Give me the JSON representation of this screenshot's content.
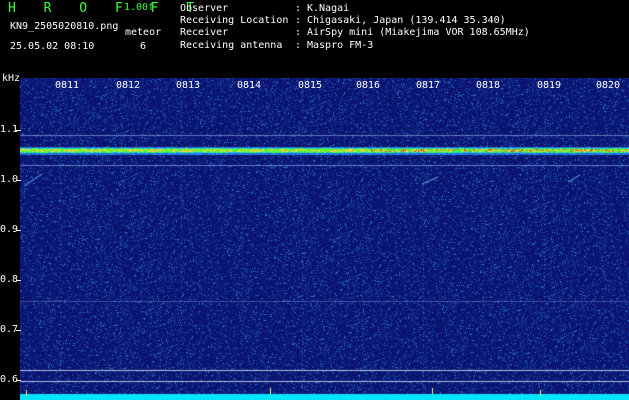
{
  "header": {
    "title": "H R O F F T",
    "version": "1.00f",
    "filename": "KN9_2505020810.png",
    "meteor_label": "meteor",
    "datetime": "25.05.02 08:10",
    "meteor_count": "6"
  },
  "info": [
    {
      "label": "Observer",
      "value": "K.Nagai"
    },
    {
      "label": "Receiving Location",
      "value": "Chigasaki, Japan (139.414 35.340)"
    },
    {
      "label": "Receiver",
      "value": "AirSpy mini (Miakejima VOR 108.65MHz)"
    },
    {
      "label": "Receiving antenna",
      "value": "Maspro FM-3"
    }
  ],
  "axis": {
    "unit": "kHz",
    "y_labels": [
      "1.1",
      "1.0",
      "0.9",
      "0.8",
      "0.7",
      "0.6"
    ],
    "time_labels": [
      "0811",
      "0812",
      "0813",
      "0814",
      "0815",
      "0816",
      "0817",
      "0818",
      "0819",
      "0820"
    ]
  },
  "colors": {
    "background": "#000000",
    "spectrum_base": "#0a1470",
    "carrier_green": "#39ff39",
    "carrier_red": "#ff3030",
    "noise_floor": "#00e5ff",
    "text_white": "#ffffff"
  }
}
